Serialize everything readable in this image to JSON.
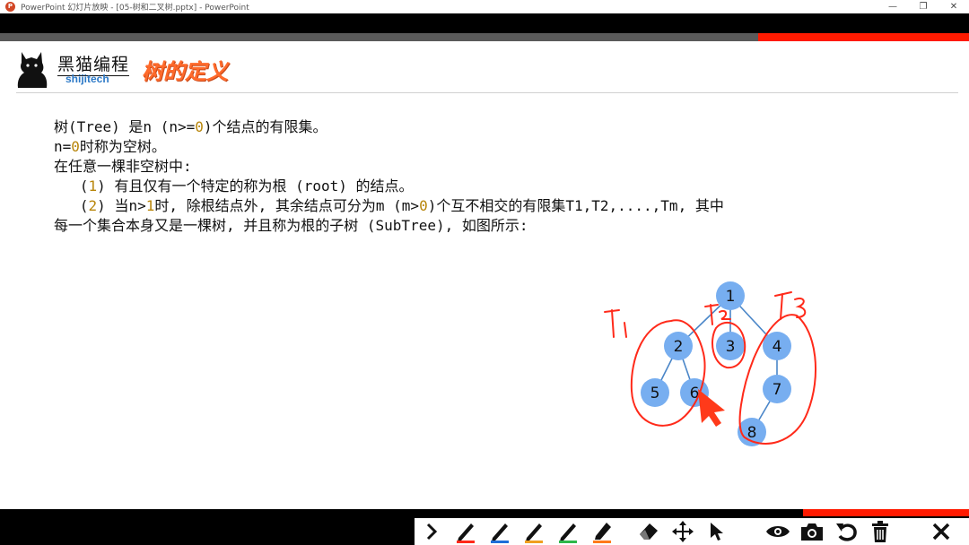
{
  "window": {
    "title": "PowerPoint 幻灯片放映 - [05-树和二叉树.pptx] - PowerPoint",
    "controls": {
      "minimize": "—",
      "restore": "❐",
      "close": "✕"
    }
  },
  "header": {
    "brand": "黑猫编程",
    "brand_sub": "shijitech",
    "title": "树的定义"
  },
  "body": {
    "lines": [
      [
        {
          "t": "树(Tree) 是n (n>="
        },
        {
          "t": "0",
          "num": true
        },
        {
          "t": ")个结点的有限集。"
        }
      ],
      [
        {
          "t": "n="
        },
        {
          "t": "0",
          "num": true
        },
        {
          "t": "时称为空树。"
        }
      ],
      [
        {
          "t": "在任意一棵非空树中:"
        }
      ],
      [
        {
          "t": "   ("
        },
        {
          "t": "1",
          "num": true
        },
        {
          "t": ") 有且仅有一个特定的称为根 (root) 的结点。"
        }
      ],
      [
        {
          "t": "   ("
        },
        {
          "t": "2",
          "num": true
        },
        {
          "t": ") 当n>"
        },
        {
          "t": "1",
          "num": true
        },
        {
          "t": "时, 除根结点外, 其余结点可分为m (m>"
        },
        {
          "t": "0",
          "num": true
        },
        {
          "t": ")个互不相交的有限集T1,T2,....,Tm, 其中"
        }
      ],
      [
        {
          "t": "每一个集合本身又是一棵树, 并且称为根的子树 (SubTree), 如图所示:"
        }
      ]
    ]
  },
  "tree": {
    "nodes": [
      "1",
      "2",
      "3",
      "4",
      "5",
      "6",
      "7",
      "8"
    ],
    "annotations": [
      "T1",
      "T2",
      "T3"
    ],
    "node_color": "#77aef0",
    "ink_color": "#ff2a1a"
  },
  "toolbar": {
    "tools": [
      "chevron-right-icon",
      "red-pen-icon",
      "blue-pen-icon",
      "orange-pen-icon",
      "green-pen-icon",
      "orange-highlighter-icon",
      "eraser-icon",
      "move-icon",
      "pointer-icon",
      "eye-icon",
      "camera-icon",
      "undo-icon",
      "trash-icon",
      "close-icon"
    ]
  }
}
